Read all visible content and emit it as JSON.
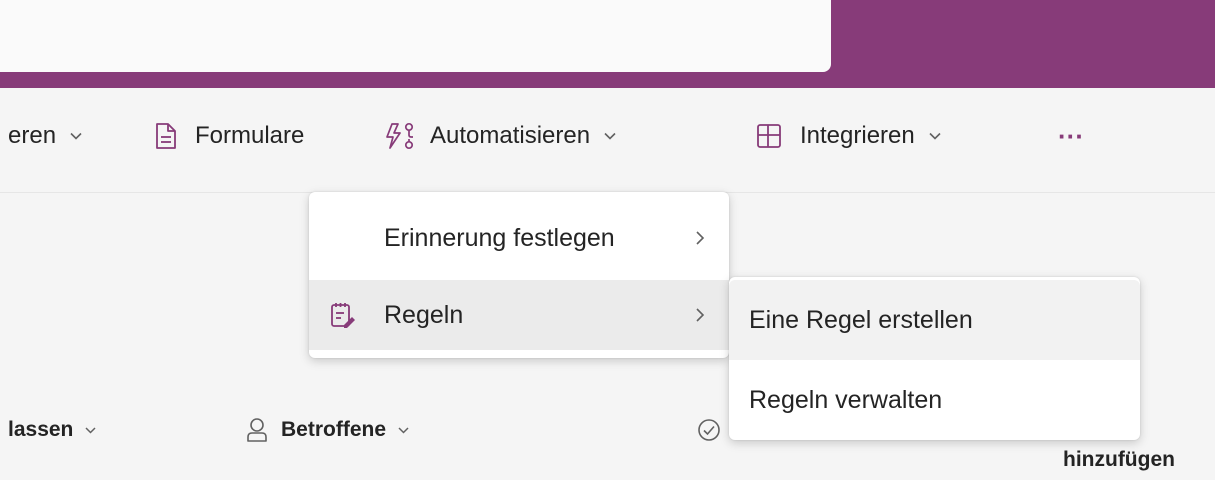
{
  "commandbar": {
    "item_partial_left": "eren",
    "forms_label": "Formulare",
    "automate_label": "Automatisieren",
    "integrate_label": "Integrieren",
    "more_label": "···"
  },
  "menu": {
    "items": [
      {
        "label": "Erinnerung festlegen",
        "icon": null
      },
      {
        "label": "Regeln",
        "icon": "rules-icon"
      }
    ]
  },
  "submenu": {
    "items": [
      {
        "label": "Eine Regel erstellen"
      },
      {
        "label": "Regeln verwalten"
      }
    ]
  },
  "bottom": {
    "item_partial_left": "lassen",
    "affected_label": "Betroffene",
    "add_label": "hinzufügen"
  },
  "colors": {
    "header": "#873b79",
    "accent": "#873b79"
  }
}
